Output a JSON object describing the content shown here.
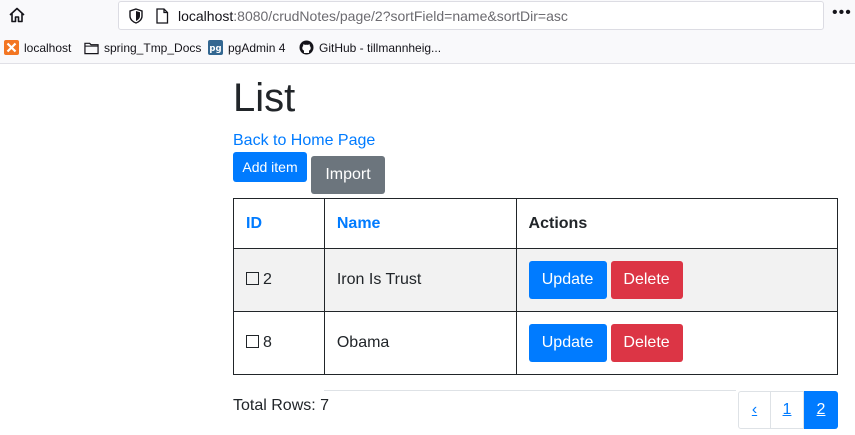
{
  "browser": {
    "url_host": "localhost",
    "url_rest": ":8080/crudNotes/page/2?sortField=name&sortDir=asc",
    "more_label": "•••",
    "bookmarks": [
      {
        "label": "localhost",
        "icon": "xampp-icon"
      },
      {
        "label": "spring_Tmp_Docs",
        "icon": "folder-icon"
      },
      {
        "label": "pgAdmin 4",
        "icon": "pgadmin-icon"
      },
      {
        "label": "GitHub - tillmannheig...",
        "icon": "github-icon"
      }
    ]
  },
  "page": {
    "title": "List",
    "home_link": "Back to Home Page",
    "add_button": "Add item",
    "import_button": "Import"
  },
  "table": {
    "headers": [
      "ID",
      "Name",
      "Actions"
    ],
    "rows": [
      {
        "id": "2",
        "name": "Iron Is Trust"
      },
      {
        "id": "8",
        "name": "Obama"
      }
    ],
    "update_label": "Update",
    "delete_label": "Delete"
  },
  "footer": {
    "total_rows": "Total Rows: 7",
    "pagination": {
      "prev": "‹",
      "pages": [
        "1",
        "2"
      ],
      "active": "2"
    }
  },
  "colors": {
    "primary": "#007bff",
    "secondary": "#6c757d",
    "danger": "#dc3545"
  }
}
